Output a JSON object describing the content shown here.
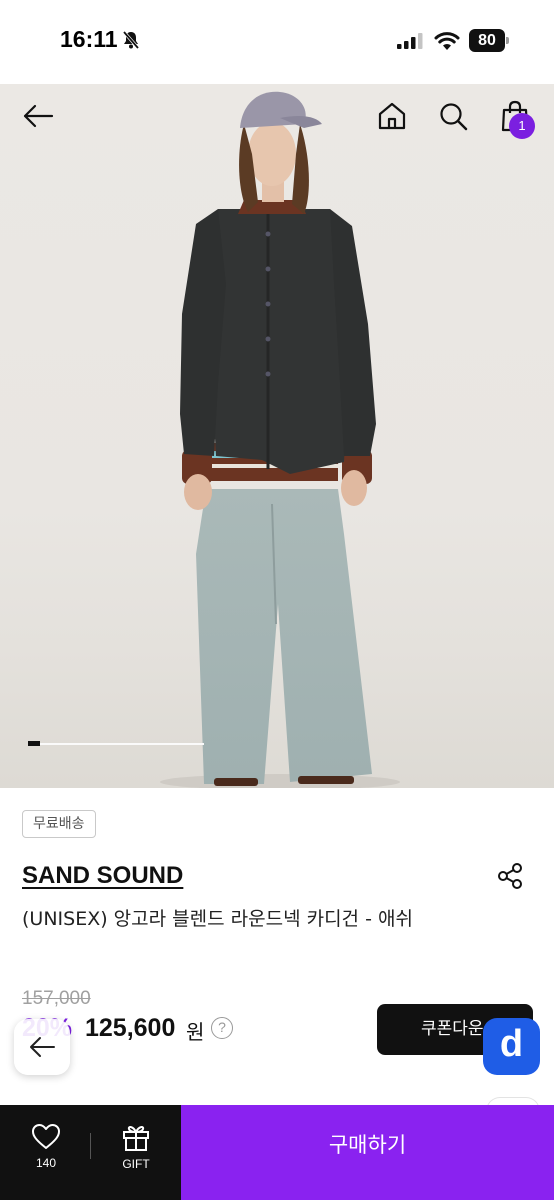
{
  "status_bar": {
    "time": "16:11",
    "battery": "80",
    "icons": [
      "bell-off-icon",
      "signal-icon",
      "wifi-icon",
      "battery-icon"
    ]
  },
  "header": {
    "icons": [
      "back-arrow-icon",
      "home-icon",
      "search-icon",
      "shopping-bag-icon"
    ],
    "cart_count": "1"
  },
  "gallery": {
    "slide_progress": 0.07
  },
  "product": {
    "shipping_badge": "무료배송",
    "brand": "SAND SOUND",
    "title": "(UNISEX) 앙고라 블렌드 라운드넥 카디건 - 애쉬",
    "original_price": "157,000",
    "discount_rate": "20%",
    "sale_price": "125,600",
    "currency": "원",
    "help_symbol": "?",
    "coupon_button": "쿠폰다운"
  },
  "floating": {
    "logo_letter": "d"
  },
  "bottom_bar": {
    "like_count": "140",
    "gift_label": "GIFT",
    "buy_label": "구매하기"
  },
  "colors": {
    "accent": "#8a22f0",
    "discount": "#7b1fe0",
    "logo_blue": "#1f5de6",
    "dark": "#111111"
  }
}
